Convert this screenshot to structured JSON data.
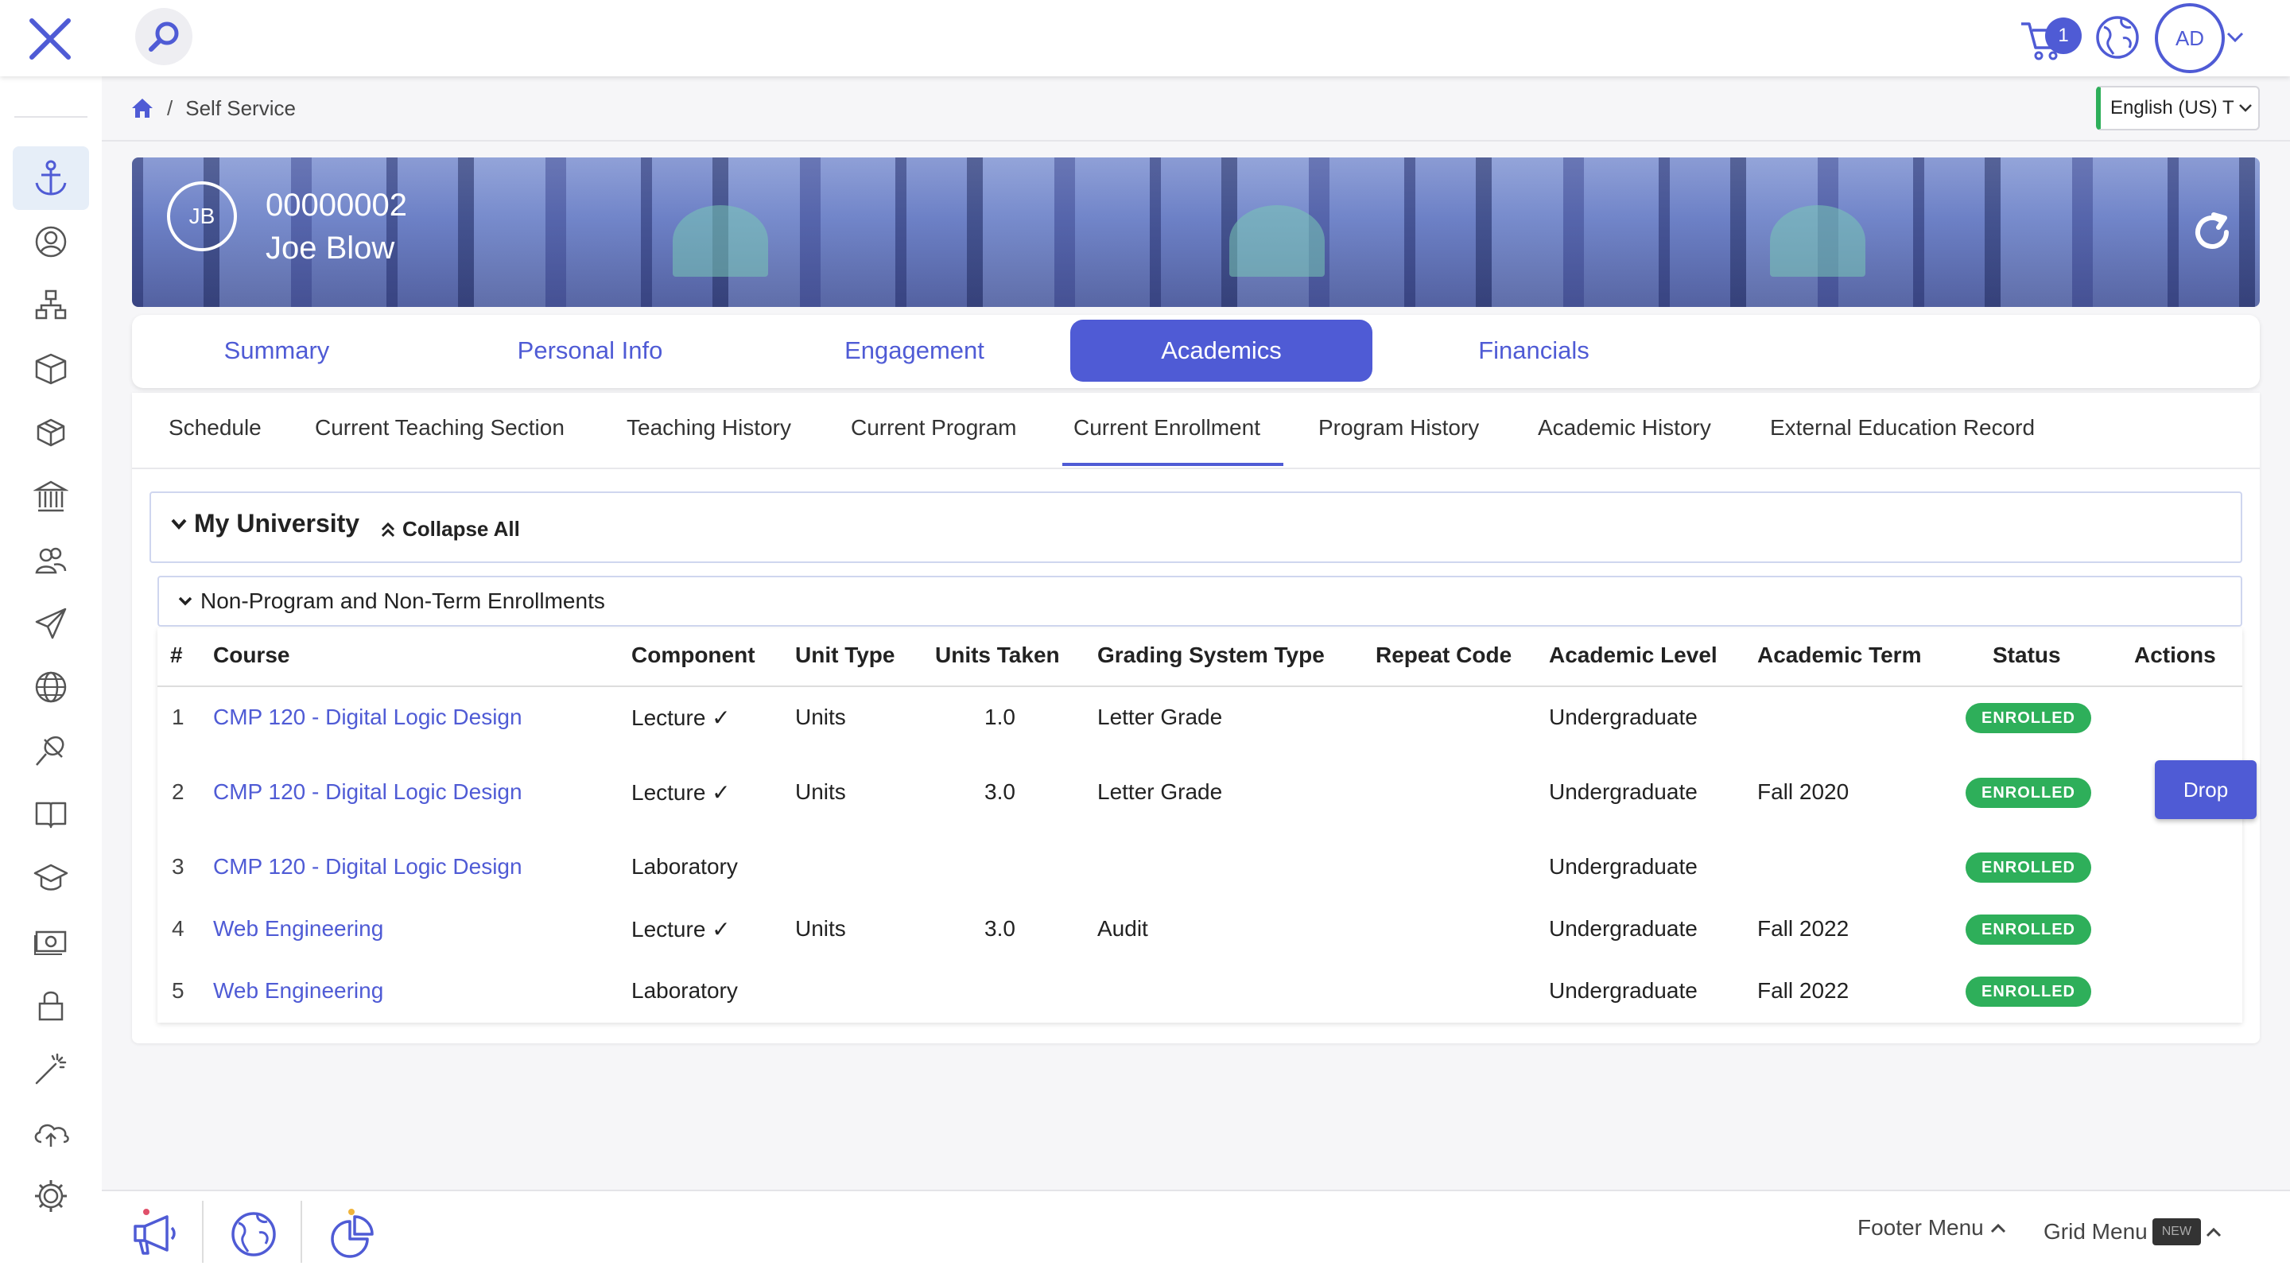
{
  "topbar": {
    "cart_count": "1",
    "avatar_initials": "AD"
  },
  "breadcrumb": {
    "current": "Self Service",
    "separator": "/"
  },
  "language": {
    "selected": "English (US) T"
  },
  "banner": {
    "initials": "JB",
    "id": "00000002",
    "name": "Joe Blow"
  },
  "main_tabs": [
    {
      "label": "Summary"
    },
    {
      "label": "Personal Info"
    },
    {
      "label": "Engagement"
    },
    {
      "label": "Academics"
    },
    {
      "label": "Financials"
    }
  ],
  "sub_tabs": [
    {
      "label": "Schedule"
    },
    {
      "label": "Current Teaching Section"
    },
    {
      "label": "Teaching History"
    },
    {
      "label": "Current Program"
    },
    {
      "label": "Current Enrollment"
    },
    {
      "label": "Program History"
    },
    {
      "label": "Academic History"
    },
    {
      "label": "External Education Record"
    }
  ],
  "panel": {
    "title": "My University",
    "collapse_all": "Collapse All",
    "group_title": "Non-Program and Non-Term Enrollments"
  },
  "table": {
    "headers": [
      "#",
      "Course",
      "Component",
      "Unit Type",
      "Units Taken",
      "Grading System Type",
      "Repeat Code",
      "Academic Level",
      "Academic Term",
      "Status",
      "Actions"
    ],
    "rows": [
      {
        "num": "1",
        "course": "CMP 120 - Digital Logic Design",
        "component": "Lecture ✓",
        "unit_type": "Units",
        "units": "1.0",
        "grading": "Letter Grade",
        "repeat": "",
        "level": "Undergraduate",
        "term": "",
        "status": "ENROLLED",
        "action": ""
      },
      {
        "num": "2",
        "course": "CMP 120 - Digital Logic Design",
        "component": "Lecture ✓",
        "unit_type": "Units",
        "units": "3.0",
        "grading": "Letter Grade",
        "repeat": "",
        "level": "Undergraduate",
        "term": "Fall 2020",
        "status": "ENROLLED",
        "action": "Drop"
      },
      {
        "num": "3",
        "course": "CMP 120 - Digital Logic Design",
        "component": "Laboratory",
        "unit_type": "",
        "units": "",
        "grading": "",
        "repeat": "",
        "level": "Undergraduate",
        "term": "",
        "status": "ENROLLED",
        "action": ""
      },
      {
        "num": "4",
        "course": "Web Engineering",
        "component": "Lecture ✓",
        "unit_type": "Units",
        "units": "3.0",
        "grading": "Audit",
        "repeat": "",
        "level": "Undergraduate",
        "term": "Fall 2022",
        "status": "ENROLLED",
        "action": ""
      },
      {
        "num": "5",
        "course": "Web Engineering",
        "component": "Laboratory",
        "unit_type": "",
        "units": "",
        "grading": "",
        "repeat": "",
        "level": "Undergraduate",
        "term": "Fall 2022",
        "status": "ENROLLED",
        "action": ""
      }
    ]
  },
  "footer": {
    "footer_menu": "Footer Menu",
    "grid_menu": "Grid Menu",
    "new_badge": "NEW"
  },
  "colors": {
    "accent": "#4f5bd5",
    "status_enrolled": "#2eaf5a"
  }
}
